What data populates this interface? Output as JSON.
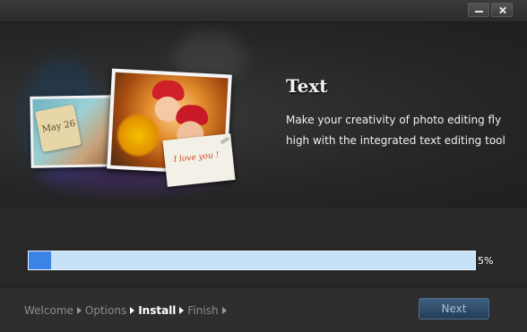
{
  "window": {
    "controls": {
      "minimize_icon": "minimize-icon",
      "close_icon": "close-icon"
    }
  },
  "hero": {
    "title": "Text",
    "description": "Make your creativity of photo editing fly high with the integrated text editing tool",
    "photo_tag_text": "May 26",
    "photo_note_text": "I love you !"
  },
  "progress": {
    "percent": 5,
    "label": "5%",
    "colors": {
      "fill": "#3b84e6",
      "track": "#c7e1f7"
    }
  },
  "footer": {
    "steps": [
      {
        "label": "Welcome",
        "active": false
      },
      {
        "label": "Options",
        "active": false
      },
      {
        "label": "Install",
        "active": true
      },
      {
        "label": "Finish",
        "active": false
      }
    ],
    "next_label": "Next"
  }
}
